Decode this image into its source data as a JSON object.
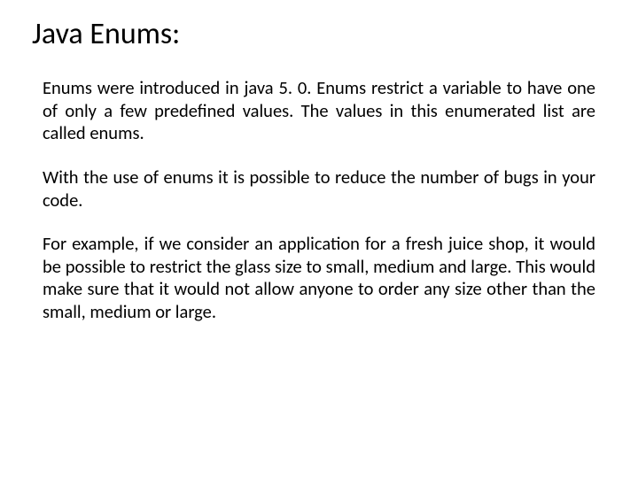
{
  "title": "Java Enums:",
  "paragraphs": [
    "Enums were introduced in java 5. 0. Enums restrict a variable to have one of only a few predefined values. The values in this enumerated list are called enums.",
    "With the use of enums it is possible to reduce the number of bugs in your code.",
    "For example, if we consider an application for a fresh juice shop, it would be possible to restrict the glass size to small, medium and large. This would make sure that it would not allow anyone to order any size other than the small, medium or large."
  ]
}
